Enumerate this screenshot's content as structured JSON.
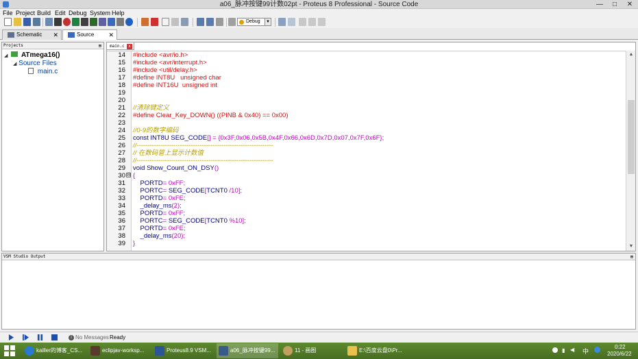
{
  "window": {
    "title": "a06_脉冲按键99计数02pt - Proteus 8 Professional - Source Code",
    "minimize": "—",
    "maximize": "□",
    "close": "✕"
  },
  "menu": [
    "File",
    "Project",
    "Build",
    "Edit",
    "Debug",
    "System",
    "Help"
  ],
  "toolbar": {
    "build_config": "Debug"
  },
  "tabs": [
    {
      "label": "Schematic Capture",
      "close": "✕"
    },
    {
      "label": "Source Code",
      "close": "✕"
    }
  ],
  "projects": {
    "header": "Projects",
    "pin": "⊞",
    "root": "ATmega16()",
    "folder": "Source Files",
    "file": "main.c"
  },
  "editor": {
    "file_tab": "main.c",
    "file_tab_close": "x",
    "lines": [
      {
        "n": "14",
        "code": "#include <avr/io.h>"
      },
      {
        "n": "15",
        "code": "#include <avr/interrupt.h>"
      },
      {
        "n": "16",
        "code": "#include <util/delay.h>"
      },
      {
        "n": "17",
        "code": "#define INT8U   unsigned char"
      },
      {
        "n": "18",
        "code": "#define INT16U  unsigned int"
      },
      {
        "n": "19",
        "code": ""
      },
      {
        "n": "20",
        "code": ""
      },
      {
        "n": "21",
        "code": "//清除键定义"
      },
      {
        "n": "22",
        "code": "#define Clear_Key_DOWN() ((PINB & 0x40) == 0x00)"
      },
      {
        "n": "23",
        "code": ""
      },
      {
        "n": "24",
        "code": "//0-9的数字编码"
      },
      {
        "n": "25",
        "code_parts": [
          {
            "t": "const INT8U SEG_CODE",
            "c": "c-txt"
          },
          {
            "t": "[] = {",
            "c": "c-br"
          },
          {
            "t": "0x3F,0x06,0x5B,0x4F,0x66,0x6D,0x7D,0x07,0x7F,0x6F",
            "c": "c-num"
          },
          {
            "t": "};",
            "c": "c-br"
          }
        ]
      },
      {
        "n": "26",
        "code": "//---------------------------------------------------------------"
      },
      {
        "n": "27",
        "code": "// 在数码管上显示计数值"
      },
      {
        "n": "28",
        "code": "//---------------------------------------------------------------"
      },
      {
        "n": "29",
        "code_parts": [
          {
            "t": "void Show_Count_ON_DSY",
            "c": "c-txt"
          },
          {
            "t": "()",
            "c": "c-br"
          }
        ]
      },
      {
        "n": "30",
        "code": "{",
        "fold": "⊟"
      },
      {
        "n": "31",
        "code_parts": [
          {
            "t": "    PORTD",
            "c": "c-txt"
          },
          {
            "t": "= 0xFF;",
            "c": "c-num"
          }
        ]
      },
      {
        "n": "32",
        "code_parts": [
          {
            "t": "    PORTC",
            "c": "c-txt"
          },
          {
            "t": "= ",
            "c": "c-num"
          },
          {
            "t": "SEG_CODE",
            "c": "c-txt"
          },
          {
            "t": "[",
            "c": "c-br"
          },
          {
            "t": "TCNT0",
            "c": "c-txt"
          },
          {
            "t": " /10];",
            "c": "c-num"
          }
        ]
      },
      {
        "n": "33",
        "code_parts": [
          {
            "t": "    PORTD",
            "c": "c-txt"
          },
          {
            "t": "= 0xFE;",
            "c": "c-num"
          }
        ]
      },
      {
        "n": "34",
        "code_parts": [
          {
            "t": "    _delay_ms",
            "c": "c-txt"
          },
          {
            "t": "(2);",
            "c": "c-num"
          }
        ]
      },
      {
        "n": "35",
        "code_parts": [
          {
            "t": "    PORTD",
            "c": "c-txt"
          },
          {
            "t": "= 0xFF;",
            "c": "c-num"
          }
        ]
      },
      {
        "n": "36",
        "code_parts": [
          {
            "t": "    PORTC",
            "c": "c-txt"
          },
          {
            "t": "= ",
            "c": "c-num"
          },
          {
            "t": "SEG_CODE",
            "c": "c-txt"
          },
          {
            "t": "[",
            "c": "c-br"
          },
          {
            "t": "TCNT0",
            "c": "c-txt"
          },
          {
            "t": " %10];",
            "c": "c-num"
          }
        ]
      },
      {
        "n": "37",
        "code_parts": [
          {
            "t": "    PORTD",
            "c": "c-txt"
          },
          {
            "t": "= 0xFE;",
            "c": "c-num"
          }
        ]
      },
      {
        "n": "38",
        "code_parts": [
          {
            "t": "    _delay_ms",
            "c": "c-txt"
          },
          {
            "t": "(20);",
            "c": "c-num"
          }
        ]
      },
      {
        "n": "39",
        "code": "}"
      }
    ]
  },
  "output": {
    "header": "VSM Studio Output",
    "pin": "⊞"
  },
  "status": {
    "messages": "No Messages",
    "messages_icon": "i",
    "ready": "Ready"
  },
  "taskbar": {
    "items": [
      "kailler的博客_CS...",
      "eclipjav-worksp...",
      "Proteus8.9 VSM...",
      "a06_脉冲按键99...",
      "11 - 画图",
      "E:\\百度云盘0\\Pr..."
    ],
    "tray_lang": "中",
    "time": "0:22",
    "date": "2020/6/22"
  },
  "colors": {
    "preprocessor": "#d01010",
    "comment": "#b8a000",
    "identifier": "#000080",
    "number": "#c000c0",
    "taskbar": "#5e8a2e"
  }
}
